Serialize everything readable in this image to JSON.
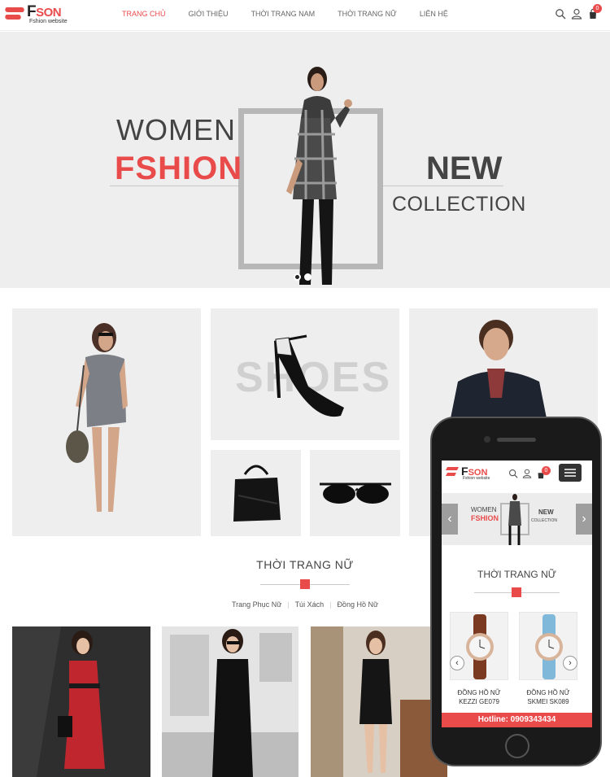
{
  "brand": {
    "logo_main": "F",
    "logo_son": "SON",
    "logo_sub": "Fshion website"
  },
  "nav": {
    "items": [
      "TRANG CHỦ",
      "GIỚI THIỆU",
      "THỜI TRANG NAM",
      "THỜI TRANG NỮ",
      "LIÊN HỆ"
    ],
    "active_index": 0
  },
  "header": {
    "cart_count": "0",
    "icons": [
      "search-icon",
      "user-icon",
      "cart-icon"
    ]
  },
  "hero": {
    "line1": "WOMEN",
    "line2": "FSHION",
    "line3": "NEW",
    "line4": "COLLECTION",
    "slide_count": 2,
    "active_slide": 0
  },
  "categories": {
    "shoes_label": "SHOES"
  },
  "section": {
    "title": "THỜI TRANG NỮ",
    "tabs": [
      "Trang Phục Nữ",
      "Túi Xách",
      "Đồng Hồ Nữ"
    ]
  },
  "mobile": {
    "logo_main": "F",
    "logo_son": "SON",
    "logo_sub": "Fshion website",
    "cart_count": "0",
    "hero_line1": "WOMEN",
    "hero_line2": "FSHION",
    "hero_line3": "NEW",
    "hero_line4": "COLLECTION",
    "section_title": "THỜI TRANG NỮ",
    "products": [
      {
        "name": "ĐỒNG HỒ NỮ",
        "code": "KEZZI GE079"
      },
      {
        "name": "ĐỒNG HỒ NỮ",
        "code": "SKMEI SK089"
      }
    ],
    "hotline": "Hotline: 0909343434"
  },
  "colors": {
    "accent": "#e94b4b",
    "hero_bg": "#eeeeee",
    "text_dark": "#444444"
  }
}
